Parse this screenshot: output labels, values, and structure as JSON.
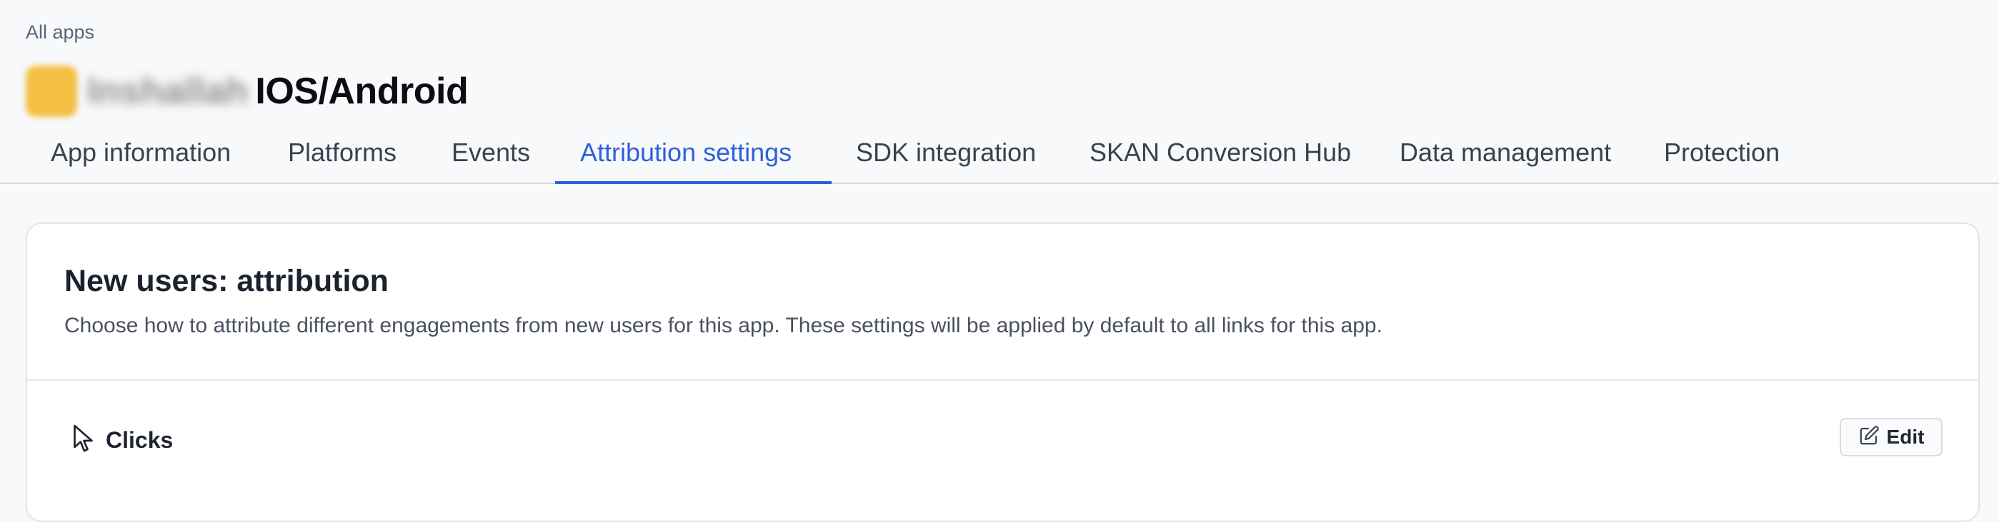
{
  "breadcrumb": "All apps",
  "app": {
    "icon": "app-icon",
    "blurred_name": "Inshallah",
    "name": "IOS/Android"
  },
  "tabs": [
    {
      "label": "App information",
      "active": false
    },
    {
      "label": "Platforms",
      "active": false
    },
    {
      "label": "Events",
      "active": false
    },
    {
      "label": "Attribution settings",
      "active": true
    },
    {
      "label": "SDK integration",
      "active": false
    },
    {
      "label": "SKAN Conversion Hub",
      "active": false
    },
    {
      "label": "Data management",
      "active": false
    },
    {
      "label": "Protection",
      "active": false
    }
  ],
  "section": {
    "title": "New users: attribution",
    "description": "Choose how to attribute different engagements from new users for this app. These settings will be applied by default to all links for this app.",
    "rows": [
      {
        "icon": "cursor-icon",
        "label": "Clicks",
        "action": {
          "icon": "edit-icon",
          "label": "Edit"
        }
      }
    ]
  },
  "colors": {
    "accent": "#2f5fde",
    "background": "#f8f9fb",
    "card": "#ffffff",
    "app_icon": "#f3c044"
  }
}
